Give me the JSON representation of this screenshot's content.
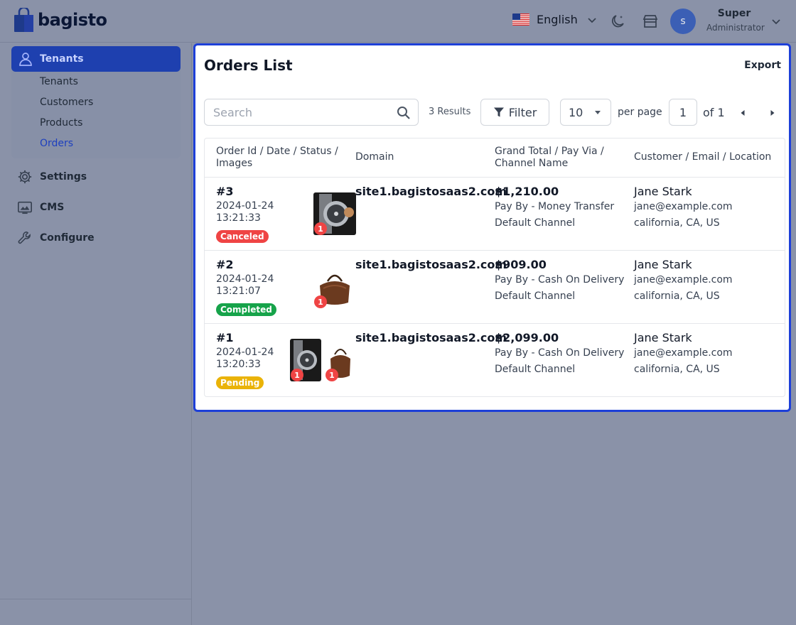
{
  "brand": {
    "name": "bagisto"
  },
  "header": {
    "language": "English",
    "user_initial": "s",
    "user_name": "Super",
    "user_role": "Administrator"
  },
  "sidebar": {
    "active_section": "Tenants",
    "sub_items": [
      "Tenants",
      "Customers",
      "Products",
      "Orders"
    ],
    "current_sub": "Orders",
    "sections": [
      "Settings",
      "CMS",
      "Configure"
    ]
  },
  "page": {
    "title": "Orders List",
    "export_label": "Export",
    "search_placeholder": "Search",
    "results": "3 Results",
    "filter_label": "Filter",
    "per_page_value": "10",
    "per_page_label": "per page",
    "page_value": "1",
    "page_of": "of 1"
  },
  "table": {
    "headers": [
      "Order Id / Date / Status / Images",
      "Domain",
      "Grand Total / Pay Via / Channel Name",
      "Customer / Email / Location"
    ],
    "rows": [
      {
        "id": "#3",
        "date": "2024-01-24 13:21:33",
        "status": "Canceled",
        "status_color": "#ef4444",
        "images": [
          {
            "kind": "watch",
            "qty": "1"
          }
        ],
        "domain": "site1.bagistosaas2.com",
        "total": "$1,210.00",
        "pay": "Pay By - Money Transfer",
        "channel": "Default Channel",
        "customer": "Jane Stark",
        "email": "jane@example.com",
        "location": "california, CA, US"
      },
      {
        "id": "#2",
        "date": "2024-01-24 13:21:07",
        "status": "Completed",
        "status_color": "#16a34a",
        "images": [
          {
            "kind": "bag",
            "qty": "1"
          }
        ],
        "domain": "site1.bagistosaas2.com",
        "total": "$909.00",
        "pay": "Pay By - Cash On Delivery",
        "channel": "Default Channel",
        "customer": "Jane Stark",
        "email": "jane@example.com",
        "location": "california, CA, US"
      },
      {
        "id": "#1",
        "date": "2024-01-24 13:20:33",
        "status": "Pending",
        "status_color": "#eab308",
        "images": [
          {
            "kind": "watch",
            "qty": "1"
          },
          {
            "kind": "bag",
            "qty": "1"
          }
        ],
        "domain": "site1.bagistosaas2.com",
        "total": "$2,099.00",
        "pay": "Pay By - Cash On Delivery",
        "channel": "Default Channel",
        "customer": "Jane Stark",
        "email": "jane@example.com",
        "location": "california, CA, US"
      }
    ]
  }
}
